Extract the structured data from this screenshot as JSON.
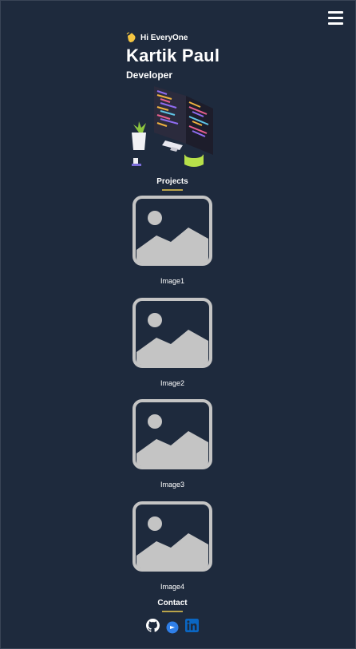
{
  "hero": {
    "greeting": "Hi EveryOne",
    "name": "Kartik Paul",
    "role": "Developer"
  },
  "sections": {
    "projects_title": "Projects",
    "contact_title": "Contact"
  },
  "projects": [
    {
      "caption": "Image1"
    },
    {
      "caption": "Image2"
    },
    {
      "caption": "Image3"
    },
    {
      "caption": "Image4"
    }
  ],
  "icons": {
    "menu": "hamburger-menu-icon",
    "wave": "waving-hand-icon",
    "github": "github-icon",
    "codepen": "blog-icon",
    "linkedin": "linkedin-icon"
  },
  "colors": {
    "background": "#1e2a3d",
    "accent": "#b9a34a",
    "placeholder": "#c4c4c4",
    "linkedin": "#0a66c2"
  }
}
